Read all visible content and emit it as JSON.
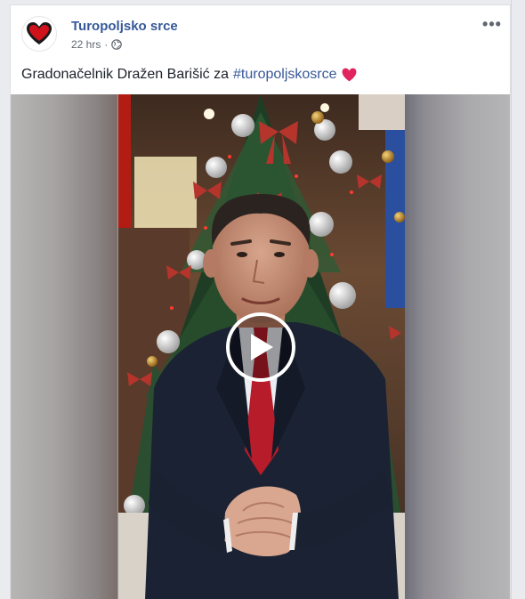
{
  "post": {
    "page_name": "Turopoljsko srce",
    "timestamp": "22 hrs",
    "separator": "·",
    "audience_icon": "globe-icon",
    "more_icon": "more-dots-icon",
    "more_label": "•••",
    "text": "Gradonačelnik Dražen Barišić za",
    "hashtag": "#turopoljskosrce",
    "emoji": "❤️"
  },
  "video": {
    "play_icon": "play-icon"
  },
  "colors": {
    "page_name": "#365899",
    "hashtag": "#385898",
    "heart": "#e0245e"
  }
}
